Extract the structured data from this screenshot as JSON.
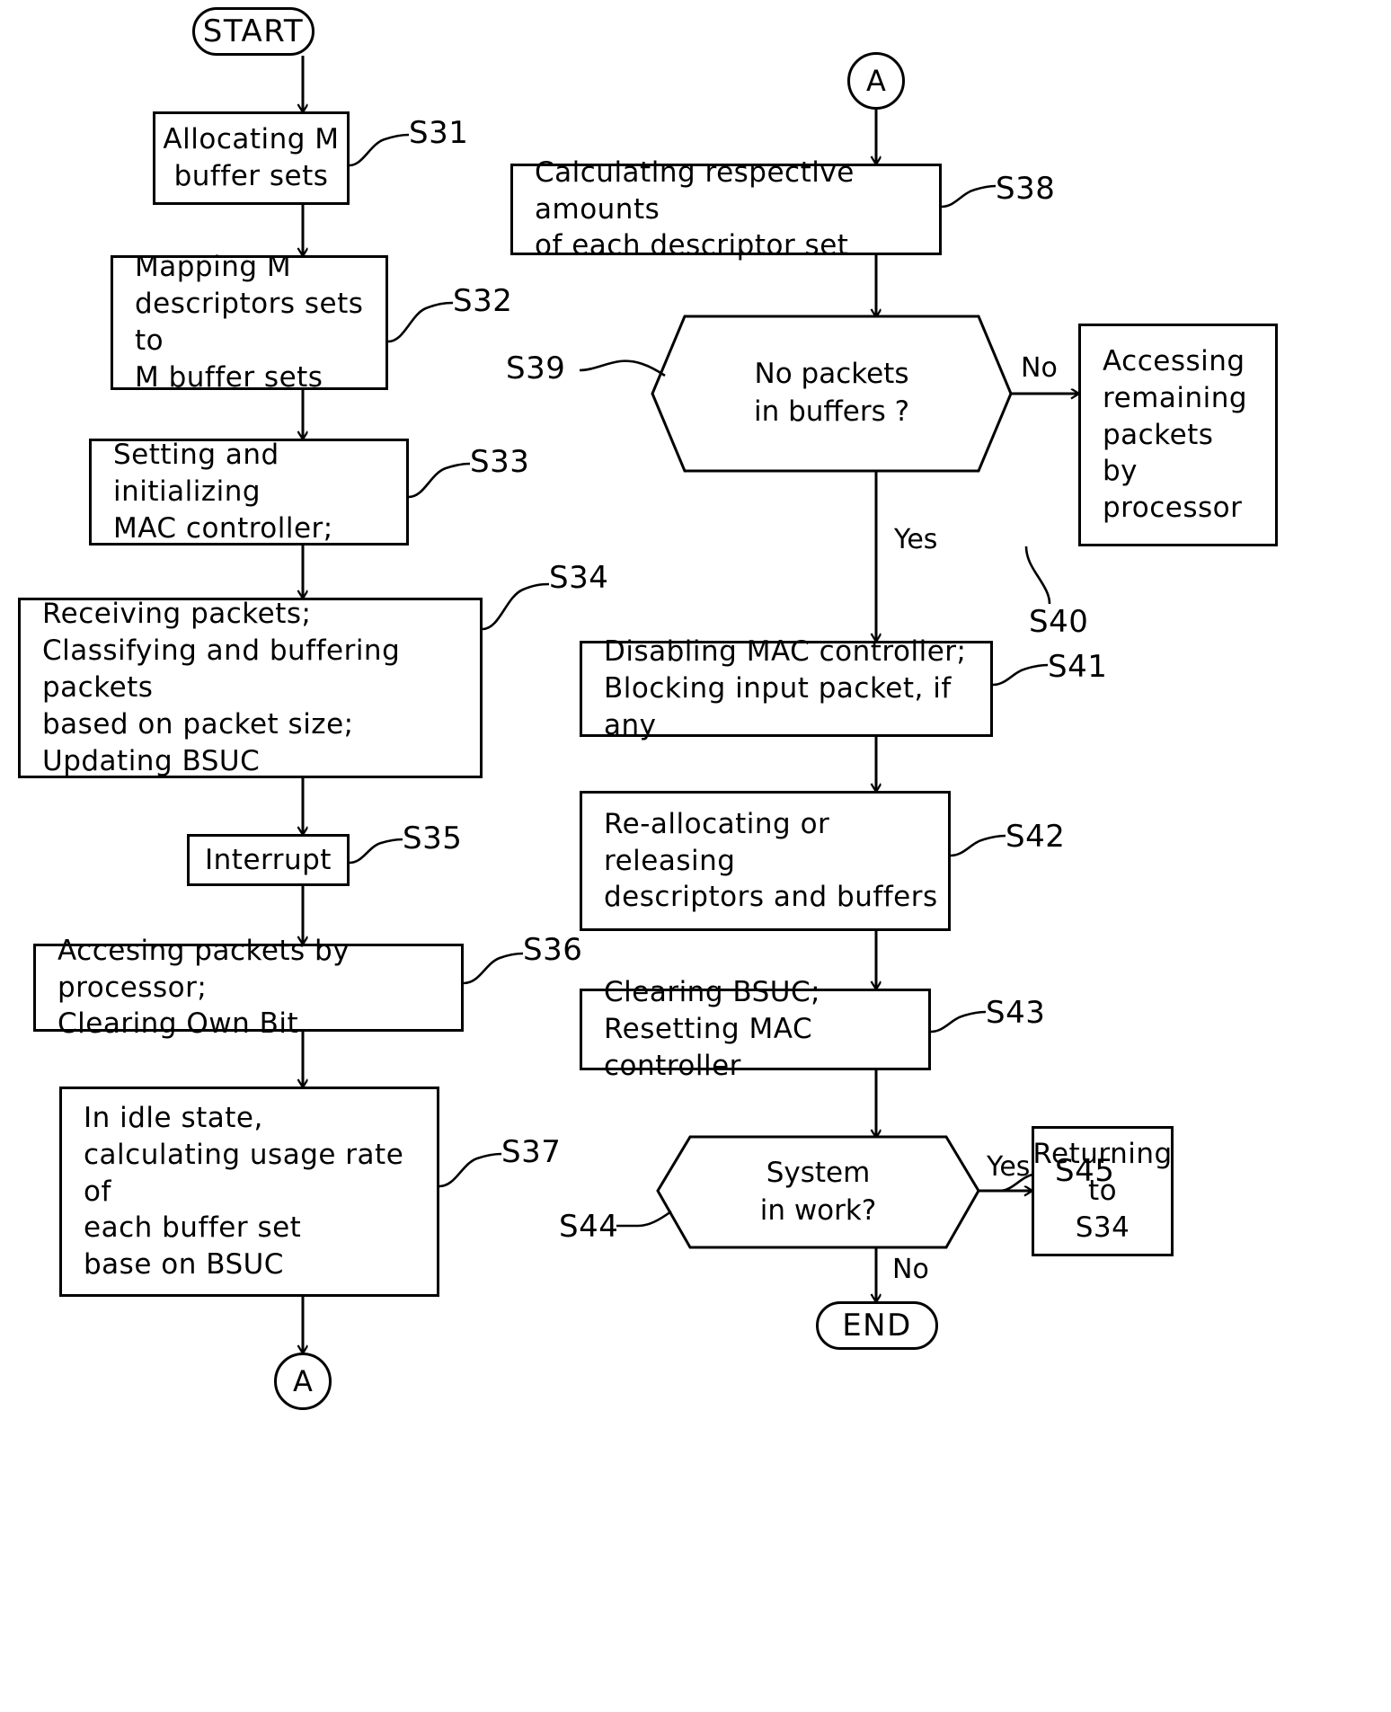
{
  "figure": {
    "type": "flowchart",
    "orientation": "two-column",
    "line_color": "#000000",
    "background": "#ffffff"
  },
  "terminators": {
    "start": "START",
    "end": "END"
  },
  "connectors": {
    "a_bottom_left": "A",
    "a_top_right": "A"
  },
  "left_column": {
    "s31": {
      "text": "Allocating M\nbuffer sets",
      "ref": "S31"
    },
    "s32": {
      "text": "Mapping M\ndescriptors sets to\nM buffer sets",
      "ref": "S32"
    },
    "s33": {
      "text": "Setting and initializing\nMAC controller;",
      "ref": "S33"
    },
    "s34": {
      "text": "Receiving packets;\nClassifying and buffering packets\nbased on packet size;\nUpdating BSUC",
      "ref": "S34"
    },
    "s35": {
      "text": "Interrupt",
      "ref": "S35"
    },
    "s36": {
      "text": "Accesing packets by processor;\nClearing Own Bit",
      "ref": "S36"
    },
    "s37": {
      "text": "In idle state,\ncalculating usage rate of\neach buffer set\nbase on BSUC",
      "ref": "S37"
    }
  },
  "right_column": {
    "s38": {
      "text": "Calculating respective amounts\nof each descriptor set",
      "ref": "S38"
    },
    "s39": {
      "text": "No packets\nin buffers ?",
      "ref": "S39",
      "shape": "hexagon"
    },
    "s40": {
      "text": "Accessing\nremaining\npackets\nby processor",
      "ref": "S40"
    },
    "s41": {
      "text": "Disabling MAC controller;\nBlocking input packet, if any",
      "ref": "S41"
    },
    "s42": {
      "text": "Re-allocating or releasing\ndescriptors and buffers",
      "ref": "S42"
    },
    "s43": {
      "text": "Clearing BSUC;\nResetting MAC controller",
      "ref": "S43"
    },
    "s44": {
      "text": "System\nin work?",
      "ref": "S44",
      "shape": "hexagon"
    },
    "s45": {
      "text": "Returning\nto\nS34",
      "ref": "S45"
    }
  },
  "edge_labels": {
    "s39_no": "No",
    "s39_yes": "Yes",
    "s44_yes": "Yes",
    "s44_no": "No"
  },
  "flow_data": {
    "nodes": [
      {
        "id": "START",
        "label": "START",
        "type": "terminator"
      },
      {
        "id": "S31",
        "label": "Allocating M buffer sets",
        "type": "process"
      },
      {
        "id": "S32",
        "label": "Mapping M descriptors sets to M buffer sets",
        "type": "process"
      },
      {
        "id": "S33",
        "label": "Setting and initializing MAC controller;",
        "type": "process"
      },
      {
        "id": "S34",
        "label": "Receiving packets; Classifying and buffering packets based on packet size; Updating BSUC",
        "type": "process"
      },
      {
        "id": "S35",
        "label": "Interrupt",
        "type": "process"
      },
      {
        "id": "S36",
        "label": "Accesing packets by processor; Clearing Own Bit",
        "type": "process"
      },
      {
        "id": "S37",
        "label": "In idle state, calculating usage rate of each buffer set base on BSUC",
        "type": "process"
      },
      {
        "id": "A",
        "label": "A",
        "type": "connector"
      },
      {
        "id": "S38",
        "label": "Calculating respective amounts of each descriptor set",
        "type": "process"
      },
      {
        "id": "S39",
        "label": "No packets in buffers ?",
        "type": "decision"
      },
      {
        "id": "S40",
        "label": "Accessing remaining packets by processor",
        "type": "process"
      },
      {
        "id": "S41",
        "label": "Disabling MAC controller; Blocking input packet, if any",
        "type": "process"
      },
      {
        "id": "S42",
        "label": "Re-allocating or releasing descriptors and buffers",
        "type": "process"
      },
      {
        "id": "S43",
        "label": "Clearing BSUC; Resetting MAC controller",
        "type": "process"
      },
      {
        "id": "S44",
        "label": "System in work?",
        "type": "decision"
      },
      {
        "id": "S45",
        "label": "Returning to S34",
        "type": "process"
      },
      {
        "id": "END",
        "label": "END",
        "type": "terminator"
      }
    ],
    "edges": [
      {
        "from": "START",
        "to": "S31",
        "label": ""
      },
      {
        "from": "S31",
        "to": "S32",
        "label": ""
      },
      {
        "from": "S32",
        "to": "S33",
        "label": ""
      },
      {
        "from": "S33",
        "to": "S34",
        "label": ""
      },
      {
        "from": "S34",
        "to": "S35",
        "label": ""
      },
      {
        "from": "S35",
        "to": "S36",
        "label": ""
      },
      {
        "from": "S36",
        "to": "S37",
        "label": ""
      },
      {
        "from": "S37",
        "to": "A",
        "label": ""
      },
      {
        "from": "A",
        "to": "S38",
        "label": ""
      },
      {
        "from": "S38",
        "to": "S39",
        "label": ""
      },
      {
        "from": "S39",
        "to": "S40",
        "label": "No"
      },
      {
        "from": "S39",
        "to": "S41",
        "label": "Yes"
      },
      {
        "from": "S41",
        "to": "S42",
        "label": ""
      },
      {
        "from": "S42",
        "to": "S43",
        "label": ""
      },
      {
        "from": "S43",
        "to": "S44",
        "label": ""
      },
      {
        "from": "S44",
        "to": "S45",
        "label": "Yes"
      },
      {
        "from": "S44",
        "to": "END",
        "label": "No"
      }
    ]
  }
}
